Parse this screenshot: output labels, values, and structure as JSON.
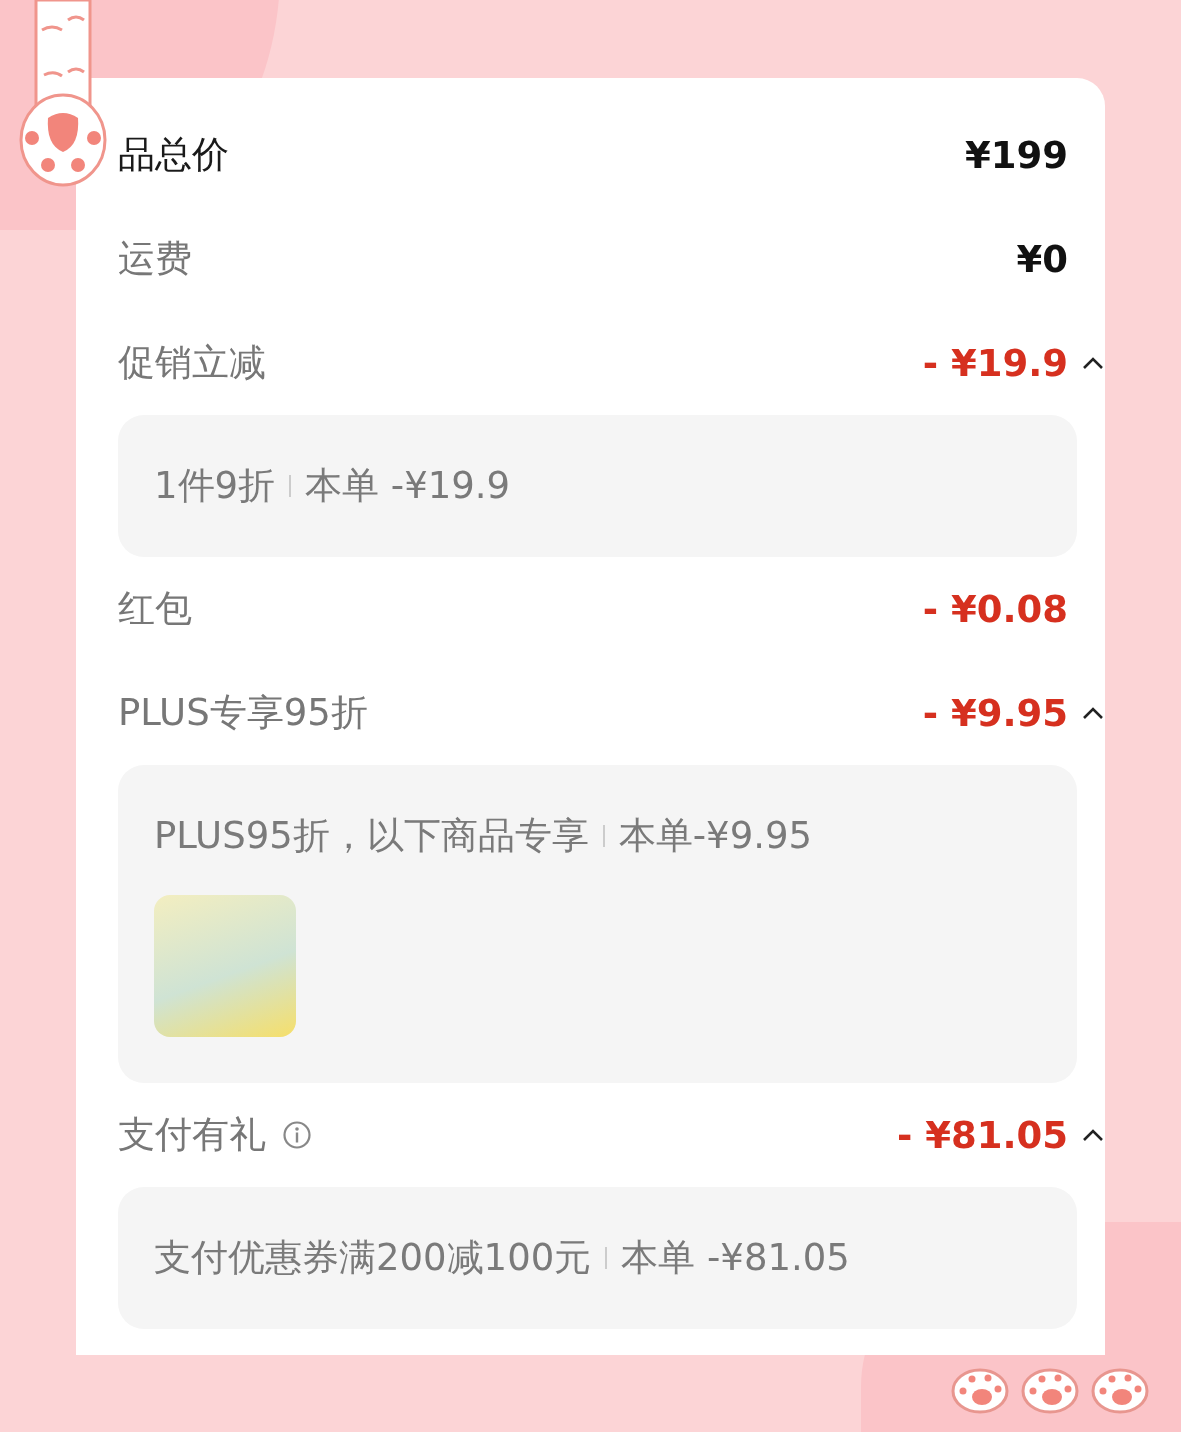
{
  "rows": [
    {
      "kind": "plain",
      "label": "品总价",
      "label_strong": true,
      "value": "¥199"
    },
    {
      "kind": "plain",
      "label": "运费",
      "label_strong": false,
      "value": "¥0"
    },
    {
      "kind": "collapsible",
      "label": "促销立减",
      "value": "- ¥19.9",
      "expanded": true,
      "detail": {
        "text": "1件9折",
        "note": "本单 -¥19.9"
      }
    },
    {
      "kind": "discount",
      "label": "红包",
      "value": "- ¥0.08"
    },
    {
      "kind": "collapsible",
      "label": "PLUS专享95折",
      "value": "- ¥9.95",
      "expanded": true,
      "detail": {
        "text": "PLUS95折，以下商品专享",
        "note": "本单-¥9.95",
        "product_photo": true
      }
    },
    {
      "kind": "collapsible",
      "label": "支付有礼",
      "info_icon": true,
      "value": "- ¥81.05",
      "expanded": true,
      "detail": {
        "text": "支付优惠券满200减100元",
        "note": "本单 -¥81.05"
      }
    }
  ]
}
